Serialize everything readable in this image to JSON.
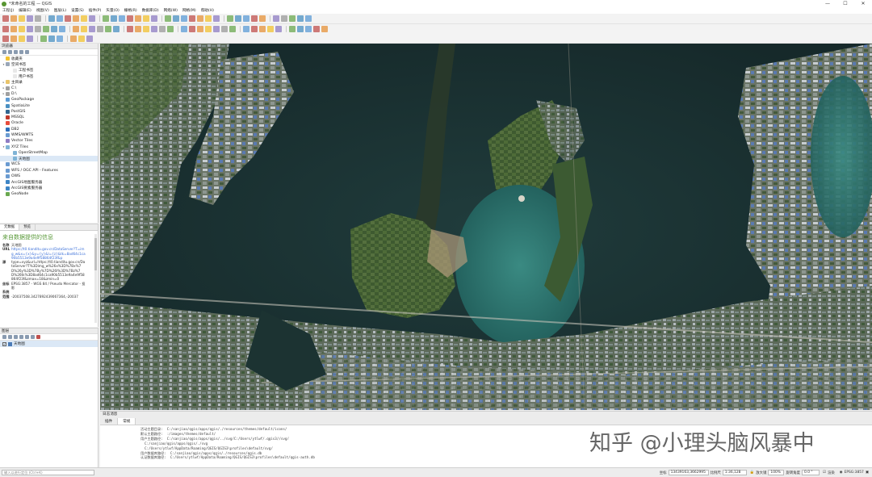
{
  "window": {
    "title": "*未命名的工程 — QGIS",
    "min": "—",
    "max": "☐",
    "close": "✕"
  },
  "menu": [
    "工程(J)",
    "编辑(E)",
    "视图(V)",
    "图层(L)",
    "设置(S)",
    "插件(P)",
    "矢量(O)",
    "栅格(R)",
    "数据库(D)",
    "网络(W)",
    "网格(M)",
    "帮助(H)"
  ],
  "browser": {
    "title": "浏览器",
    "items": [
      {
        "label": "收藏夹",
        "indent": 0,
        "arrow": "",
        "color": "#f2c230"
      },
      {
        "label": "空间书签",
        "indent": 0,
        "arrow": "▾",
        "color": "#9aa7b8"
      },
      {
        "label": "工程书签",
        "indent": 1,
        "arrow": "",
        "color": "#e8e8e8"
      },
      {
        "label": "用户书签",
        "indent": 1,
        "arrow": "",
        "color": "#e8e8e8"
      },
      {
        "label": "主目录",
        "indent": 0,
        "arrow": "▸",
        "color": "#e9c46a"
      },
      {
        "label": "C:\\",
        "indent": 0,
        "arrow": "▸",
        "color": "#a0a0a0"
      },
      {
        "label": "D:\\",
        "indent": 0,
        "arrow": "▸",
        "color": "#a0a0a0"
      },
      {
        "label": "GeoPackage",
        "indent": 0,
        "arrow": "",
        "color": "#5b9bd5"
      },
      {
        "label": "SpatiaLite",
        "indent": 0,
        "arrow": "",
        "color": "#4a90c2"
      },
      {
        "label": "PostGIS",
        "indent": 0,
        "arrow": "",
        "color": "#336791"
      },
      {
        "label": "MSSQL",
        "indent": 0,
        "arrow": "",
        "color": "#c0392b"
      },
      {
        "label": "Oracle",
        "indent": 0,
        "arrow": "",
        "color": "#e74c3c"
      },
      {
        "label": "DB2",
        "indent": 0,
        "arrow": "",
        "color": "#2c6fbb"
      },
      {
        "label": "WMS/WMTS",
        "indent": 0,
        "arrow": "",
        "color": "#6a9bd1"
      },
      {
        "label": "Vector Tiles",
        "indent": 0,
        "arrow": "",
        "color": "#8e7cc3"
      },
      {
        "label": "XYZ Tiles",
        "indent": 0,
        "arrow": "▾",
        "color": "#7fb3d5"
      },
      {
        "label": "OpenStreetMap",
        "indent": 1,
        "arrow": "",
        "color": "#7fb3d5"
      },
      {
        "label": "天地图",
        "indent": 1,
        "arrow": "",
        "color": "#7fb3d5",
        "selected": true
      },
      {
        "label": "WCS",
        "indent": 0,
        "arrow": "",
        "color": "#6a9bd1"
      },
      {
        "label": "WFS / OGC API - Features",
        "indent": 0,
        "arrow": "",
        "color": "#6a9bd1"
      },
      {
        "label": "OWS",
        "indent": 0,
        "arrow": "",
        "color": "#6a9bd1"
      },
      {
        "label": "ArcGIS地图服务器",
        "indent": 0,
        "arrow": "",
        "color": "#3d85c6"
      },
      {
        "label": "ArcGIS要素服务器",
        "indent": 0,
        "arrow": "",
        "color": "#3d85c6"
      },
      {
        "label": "GeoNode",
        "indent": 0,
        "arrow": "",
        "color": "#6aa84f"
      }
    ]
  },
  "info": {
    "tabs": [
      "元数据",
      "预览"
    ],
    "heading": "来自数据提供的信息",
    "rows": [
      {
        "k": "名称",
        "v": "天地图",
        "link": false
      },
      {
        "k": "URL",
        "v": "https://t0.tianditu.gov.cn/DataServer?T=img_w&x={x}&y={y}&l={z}&tk=8ad64c1ca90b5513e9a4e9f58864f23f&p",
        "link": true
      },
      {
        "k": "源",
        "v": "type=xyz&url=https://t0.tianditu.gov.cn/DataServer?T%3Dimg_w%26x%3D%7Bx%7D%26y%3D%7By%7D%26l%3D%7Bz%7D%26tk%3D8ad64c1ca90b5513e9a4e9f58864f23f&zmax=18&zmin=0",
        "link": false
      },
      {
        "k": "坐标",
        "v": "EPSG:3857 - WGS 84 / Pseudo Mercator - 投影",
        "link": false
      },
      {
        "k": "系统",
        "v": "",
        "link": false
      },
      {
        "k": "范围",
        "v": "-20037508.3427892439067364,-20037",
        "link": false
      }
    ]
  },
  "layers": {
    "title": "图层",
    "items": [
      {
        "label": "天地图",
        "checked": "✓"
      }
    ]
  },
  "log": {
    "title": "日志消息",
    "tabs": [
      "插件",
      "常规"
    ],
    "lines": [
      "活动主题目录:  C:/sanjiao/qgis/apps/qgis/./resources/themes/default/icons/",
      "默认主题路径:  :/images/themes/default/",
      "用户主题路径:  C:/sanjiao/qgis/apps/qgis/../svg/C:/Users/ytlwf/.qgis3//svg/",
      "  C:/sanjiao/qgis/apps/qgis/./svg",
      "  C:/Users/ytlwf/AppData/Roaming/QGIS/QGIS3\\profiles\\default/svg/",
      "用户数据库路径:  C:/sanjiao/qgis/apps/qgis/./resources/qgis.db",
      "认证数据库路径:  C:/Users/ytlwf/AppData/Roaming/QGIS/QGIS3\\profiles\\default/qgis-auth.db"
    ]
  },
  "watermark": "知乎 @小理头脑风暴中",
  "status": {
    "search_placeholder": "输入以进行定位 (Ctrl+K)",
    "coord_label": "坐标",
    "coord_value": "13439163,3662995",
    "scale_label": "比例尺",
    "scale_value": "1:36,128",
    "magnifier_label": "放大镜",
    "magnifier_value": "100%",
    "rotation_label": "旋转角度",
    "rotation_value": "0.0 °",
    "render_label": "渲染",
    "crs": "EPSG:3857"
  }
}
